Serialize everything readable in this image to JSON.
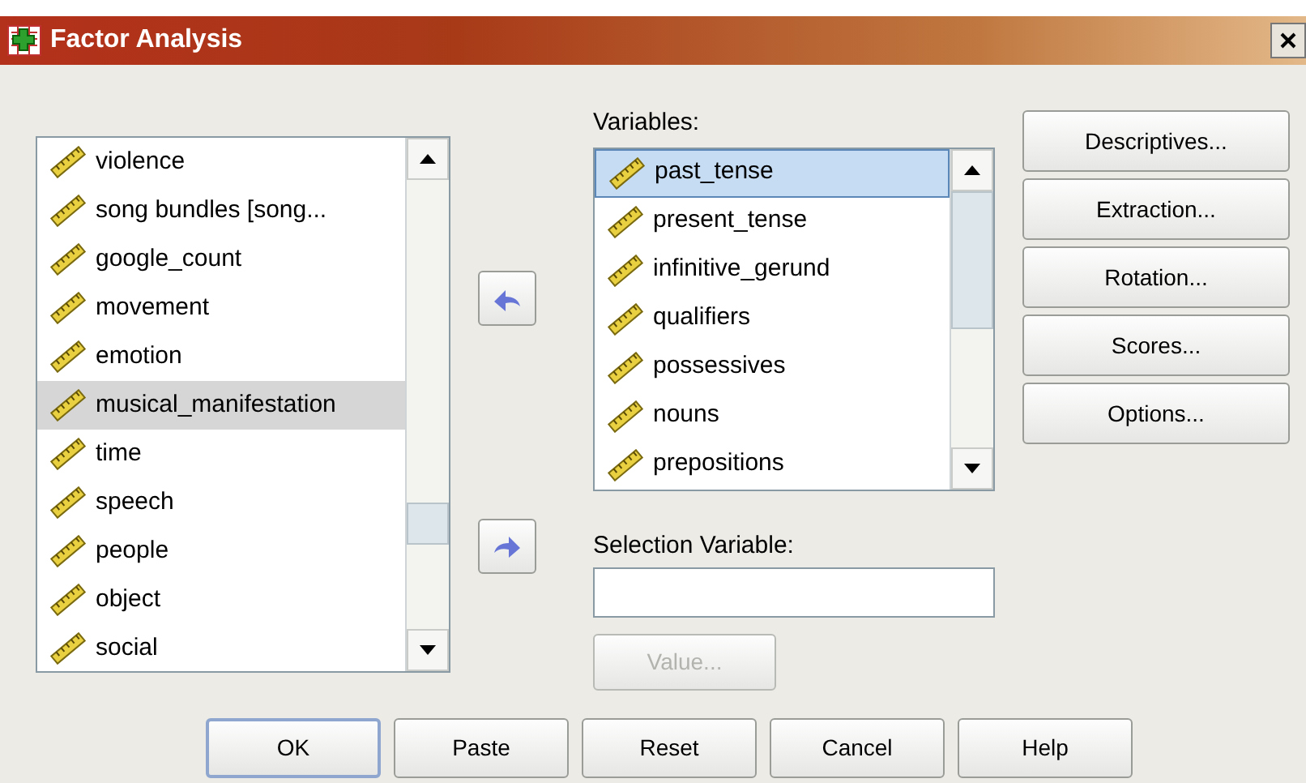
{
  "window": {
    "title": "Factor Analysis"
  },
  "source_list": {
    "focused": false,
    "items": [
      {
        "label": "violence",
        "selected": false
      },
      {
        "label": "song bundles [song...",
        "selected": false
      },
      {
        "label": "google_count",
        "selected": false
      },
      {
        "label": "movement",
        "selected": false
      },
      {
        "label": "emotion",
        "selected": false
      },
      {
        "label": "musical_manifestation",
        "selected": true
      },
      {
        "label": "time",
        "selected": false
      },
      {
        "label": "speech",
        "selected": false
      },
      {
        "label": "people",
        "selected": false
      },
      {
        "label": "object",
        "selected": false
      },
      {
        "label": "social",
        "selected": false
      }
    ]
  },
  "variables": {
    "label": "Variables:",
    "focused": true,
    "items": [
      {
        "label": "past_tense",
        "selected": true
      },
      {
        "label": "present_tense",
        "selected": false
      },
      {
        "label": "infinitive_gerund",
        "selected": false
      },
      {
        "label": "qualifiers",
        "selected": false
      },
      {
        "label": "possessives",
        "selected": false
      },
      {
        "label": "nouns",
        "selected": false
      },
      {
        "label": "prepositions",
        "selected": false
      }
    ]
  },
  "selection_variable": {
    "label": "Selection Variable:",
    "value_button": {
      "label": "Value...",
      "disabled": true
    }
  },
  "side_buttons": [
    {
      "label": "Descriptives..."
    },
    {
      "label": "Extraction..."
    },
    {
      "label": "Rotation..."
    },
    {
      "label": "Scores..."
    },
    {
      "label": "Options..."
    }
  ],
  "footer_buttons": [
    {
      "label": "OK",
      "default": true
    },
    {
      "label": "Paste",
      "default": false
    },
    {
      "label": "Reset",
      "default": false
    },
    {
      "label": "Cancel",
      "default": false
    },
    {
      "label": "Help",
      "default": false
    }
  ]
}
